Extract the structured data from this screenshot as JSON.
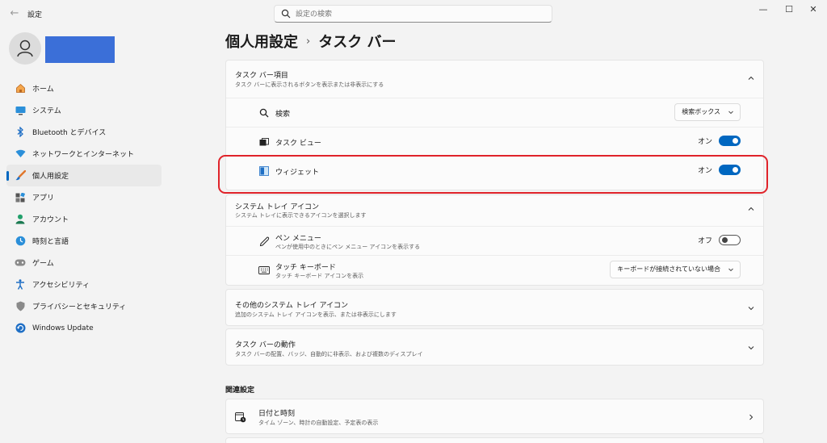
{
  "app": {
    "title": "設定",
    "back_glyph": "←"
  },
  "search": {
    "placeholder": "設定の検索"
  },
  "window_controls": {
    "minimize": "—",
    "maximize": "☐",
    "close": "✕"
  },
  "sidebar": {
    "items": [
      {
        "label": "ホーム",
        "icon": "home-icon"
      },
      {
        "label": "システム",
        "icon": "system-icon"
      },
      {
        "label": "Bluetooth とデバイス",
        "icon": "bluetooth-icon"
      },
      {
        "label": "ネットワークとインターネット",
        "icon": "wifi-icon"
      },
      {
        "label": "個人用設定",
        "icon": "brush-icon",
        "active": true
      },
      {
        "label": "アプリ",
        "icon": "apps-icon"
      },
      {
        "label": "アカウント",
        "icon": "account-icon"
      },
      {
        "label": "時刻と言語",
        "icon": "time-language-icon"
      },
      {
        "label": "ゲーム",
        "icon": "gamepad-icon"
      },
      {
        "label": "アクセシビリティ",
        "icon": "accessibility-icon"
      },
      {
        "label": "プライバシーとセキュリティ",
        "icon": "shield-icon"
      },
      {
        "label": "Windows Update",
        "icon": "update-icon"
      }
    ]
  },
  "breadcrumb": {
    "parent": "個人用設定",
    "separator": "›",
    "current": "タスク バー"
  },
  "taskbar_items": {
    "title": "タスク バー項目",
    "subtitle": "タスク バーに表示されるボタンを表示または非表示にする",
    "rows": {
      "search": {
        "label": "検索",
        "value": "検索ボックス"
      },
      "task_view": {
        "label": "タスク ビュー",
        "state": "オン"
      },
      "widgets": {
        "label": "ウィジェット",
        "state": "オン"
      }
    }
  },
  "system_tray": {
    "title": "システム トレイ アイコン",
    "subtitle": "システム トレイに表示できるアイコンを選択します",
    "rows": {
      "pen": {
        "label": "ペン メニュー",
        "sub": "ペンが使用中のときにペン メニュー アイコンを表示する",
        "state": "オフ"
      },
      "touch_keyboard": {
        "label": "タッチ キーボード",
        "sub": "タッチ キーボード アイコンを表示",
        "value": "キーボードが接続されていない場合"
      }
    }
  },
  "other_tray": {
    "title": "その他のシステム トレイ アイコン",
    "subtitle": "追加のシステム トレイ アイコンを表示、または非表示にします"
  },
  "taskbar_behavior": {
    "title": "タスク バーの動作",
    "subtitle": "タスク バーの配置、バッジ、自動的に非表示、および複数のディスプレイ"
  },
  "related": {
    "heading": "関連設定",
    "date_time": {
      "label": "日付と時刻",
      "sub": "タイム ゾーン、時計の自動設定、予定表の表示"
    }
  },
  "colors": {
    "accent": "#0067c0",
    "highlight": "#e0232a",
    "user_block": "#3b6fd8"
  }
}
